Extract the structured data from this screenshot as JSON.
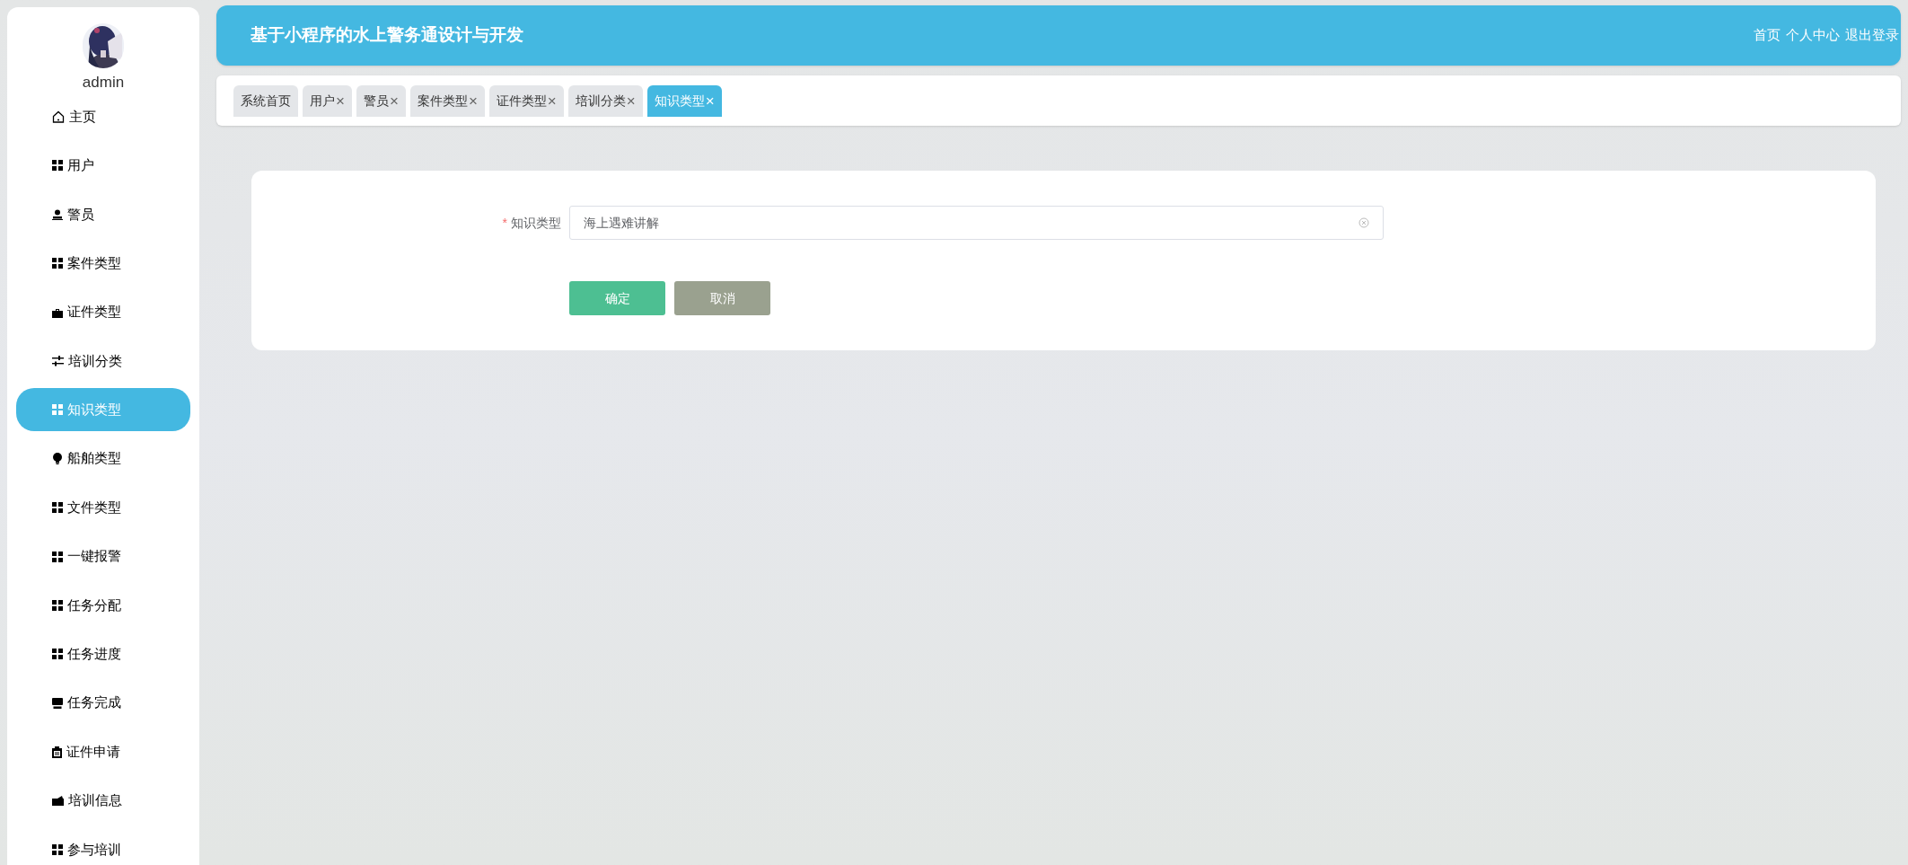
{
  "sidebar": {
    "user": {
      "name": "admin"
    },
    "items": [
      {
        "label": "主页",
        "kind": "home",
        "selected": false
      },
      {
        "label": "用户",
        "kind": "grid",
        "selected": false
      },
      {
        "label": "警员",
        "kind": "person",
        "selected": false
      },
      {
        "label": "案件类型",
        "kind": "grid",
        "selected": false
      },
      {
        "label": "证件类型",
        "kind": "briefcase",
        "selected": false
      },
      {
        "label": "培训分类",
        "kind": "sliders",
        "selected": false
      },
      {
        "label": "知识类型",
        "kind": "grid",
        "selected": true
      },
      {
        "label": "船舶类型",
        "kind": "bulb",
        "selected": false
      },
      {
        "label": "文件类型",
        "kind": "grid",
        "selected": false
      },
      {
        "label": "一键报警",
        "kind": "grid",
        "selected": false
      },
      {
        "label": "任务分配",
        "kind": "grid",
        "selected": false
      },
      {
        "label": "任务进度",
        "kind": "grid",
        "selected": false
      },
      {
        "label": "任务完成",
        "kind": "tray",
        "selected": false
      },
      {
        "label": "证件申请",
        "kind": "clipboard",
        "selected": false
      },
      {
        "label": "培训信息",
        "kind": "wallet",
        "selected": false
      },
      {
        "label": "参与培训",
        "kind": "grid",
        "selected": false
      }
    ]
  },
  "header": {
    "title": "基于小程序的水上警务通设计与开发",
    "links": [
      "首页",
      "个人中心",
      "退出登录"
    ]
  },
  "tabs": [
    {
      "label": "系统首页",
      "closable": false,
      "selected": false
    },
    {
      "label": "用户",
      "closable": true,
      "selected": false
    },
    {
      "label": "警员",
      "closable": true,
      "selected": false
    },
    {
      "label": "案件类型",
      "closable": true,
      "selected": false
    },
    {
      "label": "证件类型",
      "closable": true,
      "selected": false
    },
    {
      "label": "培训分类",
      "closable": true,
      "selected": false
    },
    {
      "label": "知识类型",
      "closable": true,
      "selected": true
    }
  ],
  "tab_close_glyph": "×",
  "form": {
    "fields": [
      {
        "label": "知识类型",
        "required": true,
        "required_mark": "*",
        "value": "海上遇难讲解"
      }
    ],
    "buttons": [
      {
        "label": "确定",
        "kind": "primary"
      },
      {
        "label": "取消",
        "kind": "secondary"
      }
    ]
  }
}
